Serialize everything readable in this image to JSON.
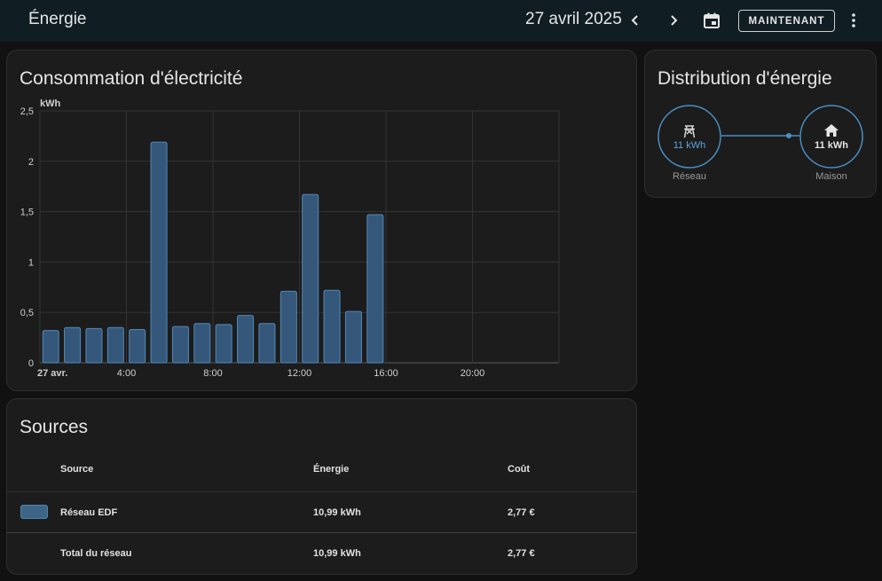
{
  "header": {
    "title": "Énergie",
    "date": "27 avril 2025",
    "now_label": "MAINTENANT"
  },
  "consumption_card": {
    "title": "Consommation d'électricité"
  },
  "chart_data": {
    "type": "bar",
    "ylabel": "kWh",
    "ylim": [
      0,
      2.5
    ],
    "y_ticks": [
      "0",
      "0,5",
      "1",
      "1,5",
      "2",
      "2,5"
    ],
    "x_tick_labels": [
      "27 avr.",
      "4:00",
      "8:00",
      "12:00",
      "16:00",
      "20:00"
    ],
    "categories": [
      "0:00",
      "1:00",
      "2:00",
      "3:00",
      "4:00",
      "5:00",
      "6:00",
      "7:00",
      "8:00",
      "9:00",
      "10:00",
      "11:00",
      "12:00",
      "13:00",
      "14:00",
      "15:00"
    ],
    "series": [
      {
        "values": [
          0.32,
          0.35,
          0.34,
          0.35,
          0.33,
          2.19,
          0.36,
          0.39,
          0.38,
          0.47,
          0.39,
          0.71,
          1.67,
          0.72,
          0.51,
          1.47
        ]
      }
    ],
    "grid": true,
    "color": "#4a7ba7"
  },
  "distribution_card": {
    "title": "Distribution d'énergie",
    "grid_node": {
      "value": "11 kWh",
      "caption": "Réseau",
      "icon": "transmission-tower-icon"
    },
    "home_node": {
      "value": "11 kWh",
      "caption": "Maison",
      "icon": "home-icon"
    },
    "colors": {
      "grid": "#488fc2",
      "home": "#488fc2"
    }
  },
  "sources_card": {
    "title": "Sources",
    "headers": {
      "source": "Source",
      "energy": "Énergie",
      "cost": "Coût"
    },
    "rows": [
      {
        "name": "Réseau EDF",
        "energy": "10,99 kWh",
        "cost": "2,77 €",
        "swatch": "#3e6587"
      }
    ],
    "total": {
      "label": "Total du réseau",
      "energy": "10,99 kWh",
      "cost": "2,77 €"
    }
  }
}
